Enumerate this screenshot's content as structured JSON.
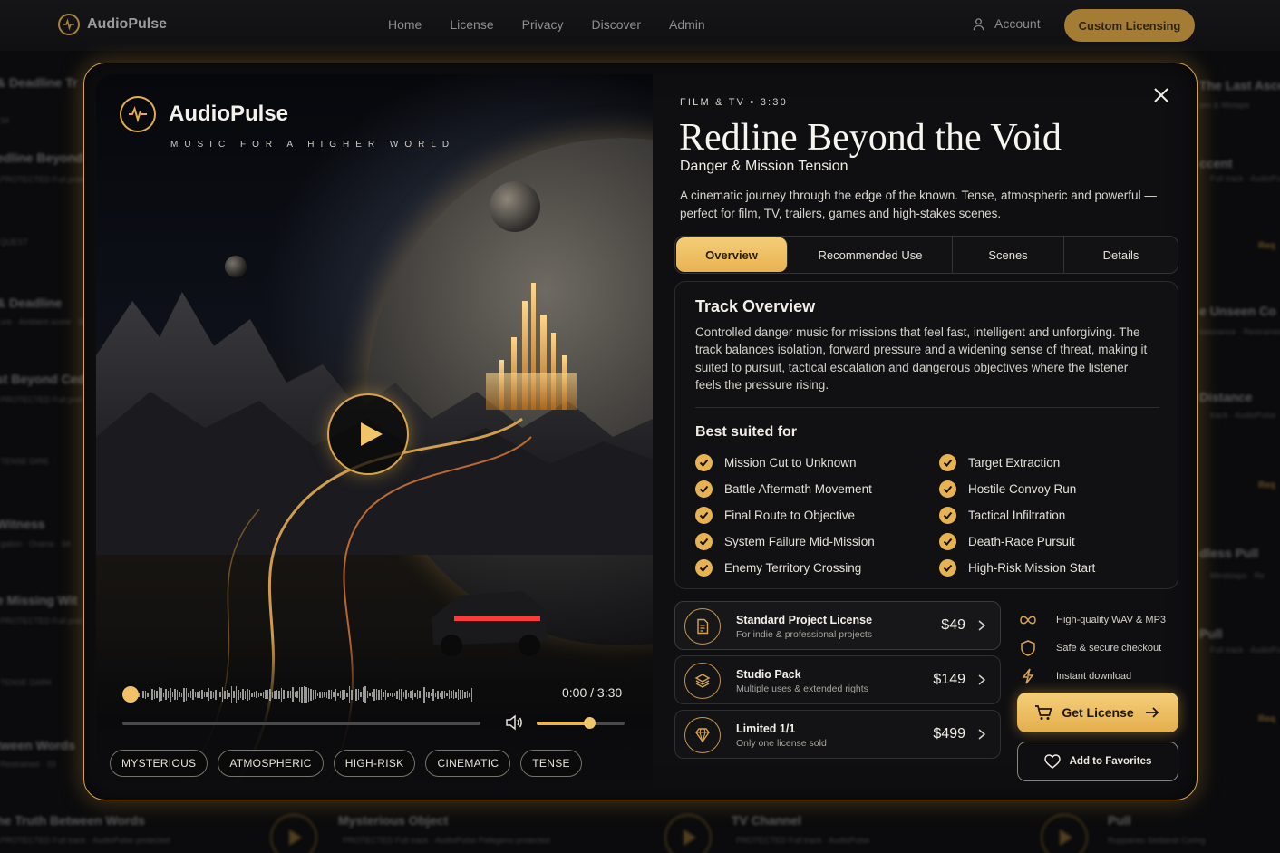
{
  "nav": {
    "brand": "AudioPulse",
    "links": [
      "Home",
      "License",
      "Privacy",
      "Discover",
      "Admin"
    ],
    "account": "Account",
    "cta": "Custom Licensing"
  },
  "background": {
    "left": [
      {
        "title": "& Deadline Tr",
        "sub": "34"
      },
      {
        "title": "edline Beyond",
        "sub": "PROTECTED   Full protec"
      },
      {
        "title": "",
        "sub": "QUEST"
      },
      {
        "title": "& Deadline",
        "sub": "ure · Ambient score · 34"
      },
      {
        "title": "st Beyond Ced",
        "sub": "PROTECTED   Full prot"
      },
      {
        "title": "",
        "sub": "TENSE        DIRE"
      },
      {
        "title": "Witness",
        "sub": "gation · Drama · 34"
      },
      {
        "title": "e Missing Wit",
        "sub": "PROTECTED   Full prot"
      },
      {
        "title": "",
        "sub": "TENSE        DARK"
      },
      {
        "title": "tween Words",
        "sub": "Restrained · 33"
      }
    ],
    "right": [
      {
        "title": "The Last Asce",
        "sub": "ore & Mixtape"
      },
      {
        "title": "ccent",
        "sub": "Full track · AudioPulse protected"
      },
      {
        "title": "e Unseen Co",
        "sub": "ssionance · Restrained"
      },
      {
        "title": "Distance",
        "sub": "track · AudioPulse"
      },
      {
        "title": "dless Pull",
        "sub": "Mindslaps · Re"
      },
      {
        "title": "Pull",
        "sub": "Full track · AudioPulse protected"
      }
    ],
    "right_req": "Req",
    "bottom": [
      {
        "title": "he Truth Between Words",
        "sub": "PROTECTED   Full track · AudioPulse protected"
      },
      {
        "title": "Mysterious Object",
        "sub": "PROTECTED   Full track · AudioPulse Pafegeno protected"
      },
      {
        "title": "TV Channel",
        "sub": "PROTECTED   Full track · AudioPulse"
      },
      {
        "title": "Pull",
        "sub": "Ruppanes   Sediandi Coring"
      }
    ]
  },
  "art": {
    "brand": "AudioPulse",
    "tagline": "MUSIC FOR A HIGHER WORLD"
  },
  "player": {
    "time": "0:00 / 3:30",
    "progress": 0,
    "volume": 0.6
  },
  "tags": [
    "MYSTERIOUS",
    "ATMOSPHERIC",
    "HIGH-RISK",
    "CINEMATIC",
    "TENSE"
  ],
  "track": {
    "eyebrow": "FILM & TV  •  3:30",
    "title": "Redline Beyond the Void",
    "subtitle": "Danger & Mission Tension",
    "description": "A cinematic journey through the edge of the known. Tense, atmospheric and powerful — perfect for film, TV, trailers, games and high-stakes scenes."
  },
  "tabs": [
    "Overview",
    "Recommended Use",
    "Scenes",
    "Details"
  ],
  "overview": {
    "title": "Track Overview",
    "text": "Controlled danger music for missions that feel fast, intelligent and unforgiving. The track balances isolation, forward pressure and a widening sense of threat, making it suited to pursuit, tactical escalation and dangerous objectives where the listener feels the pressure rising.",
    "best_title": "Best suited for",
    "best_left": [
      "Mission Cut to Unknown",
      "Battle Aftermath Movement",
      "Final Route to Objective",
      "System Failure Mid-Mission",
      "Enemy Territory Crossing"
    ],
    "best_right": [
      "Target Extraction",
      "Hostile Convoy Run",
      "Tactical Infiltration",
      "Death-Race Pursuit",
      "High-Risk Mission Start"
    ]
  },
  "licenses": [
    {
      "name": "Standard Project License",
      "sub": "For indie & professional projects",
      "price": "$49",
      "icon": "document-icon"
    },
    {
      "name": "Studio Pack",
      "sub": "Multiple uses & extended rights",
      "price": "$149",
      "icon": "layers-icon"
    },
    {
      "name": "Limited 1/1",
      "sub": "Only one license sold",
      "price": "$499",
      "icon": "diamond-icon"
    }
  ],
  "perks": [
    {
      "label": "High-quality WAV & MP3",
      "icon": "infinity-icon"
    },
    {
      "label": "Safe & secure checkout",
      "icon": "shield-icon"
    },
    {
      "label": "Instant download",
      "icon": "bolt-icon"
    }
  ],
  "actions": {
    "get_license": "Get License",
    "favorites": "Add to Favorites"
  },
  "colors": {
    "accent": "#e7b352",
    "accent_light": "#f4cd78",
    "background": "#0f0f11"
  }
}
